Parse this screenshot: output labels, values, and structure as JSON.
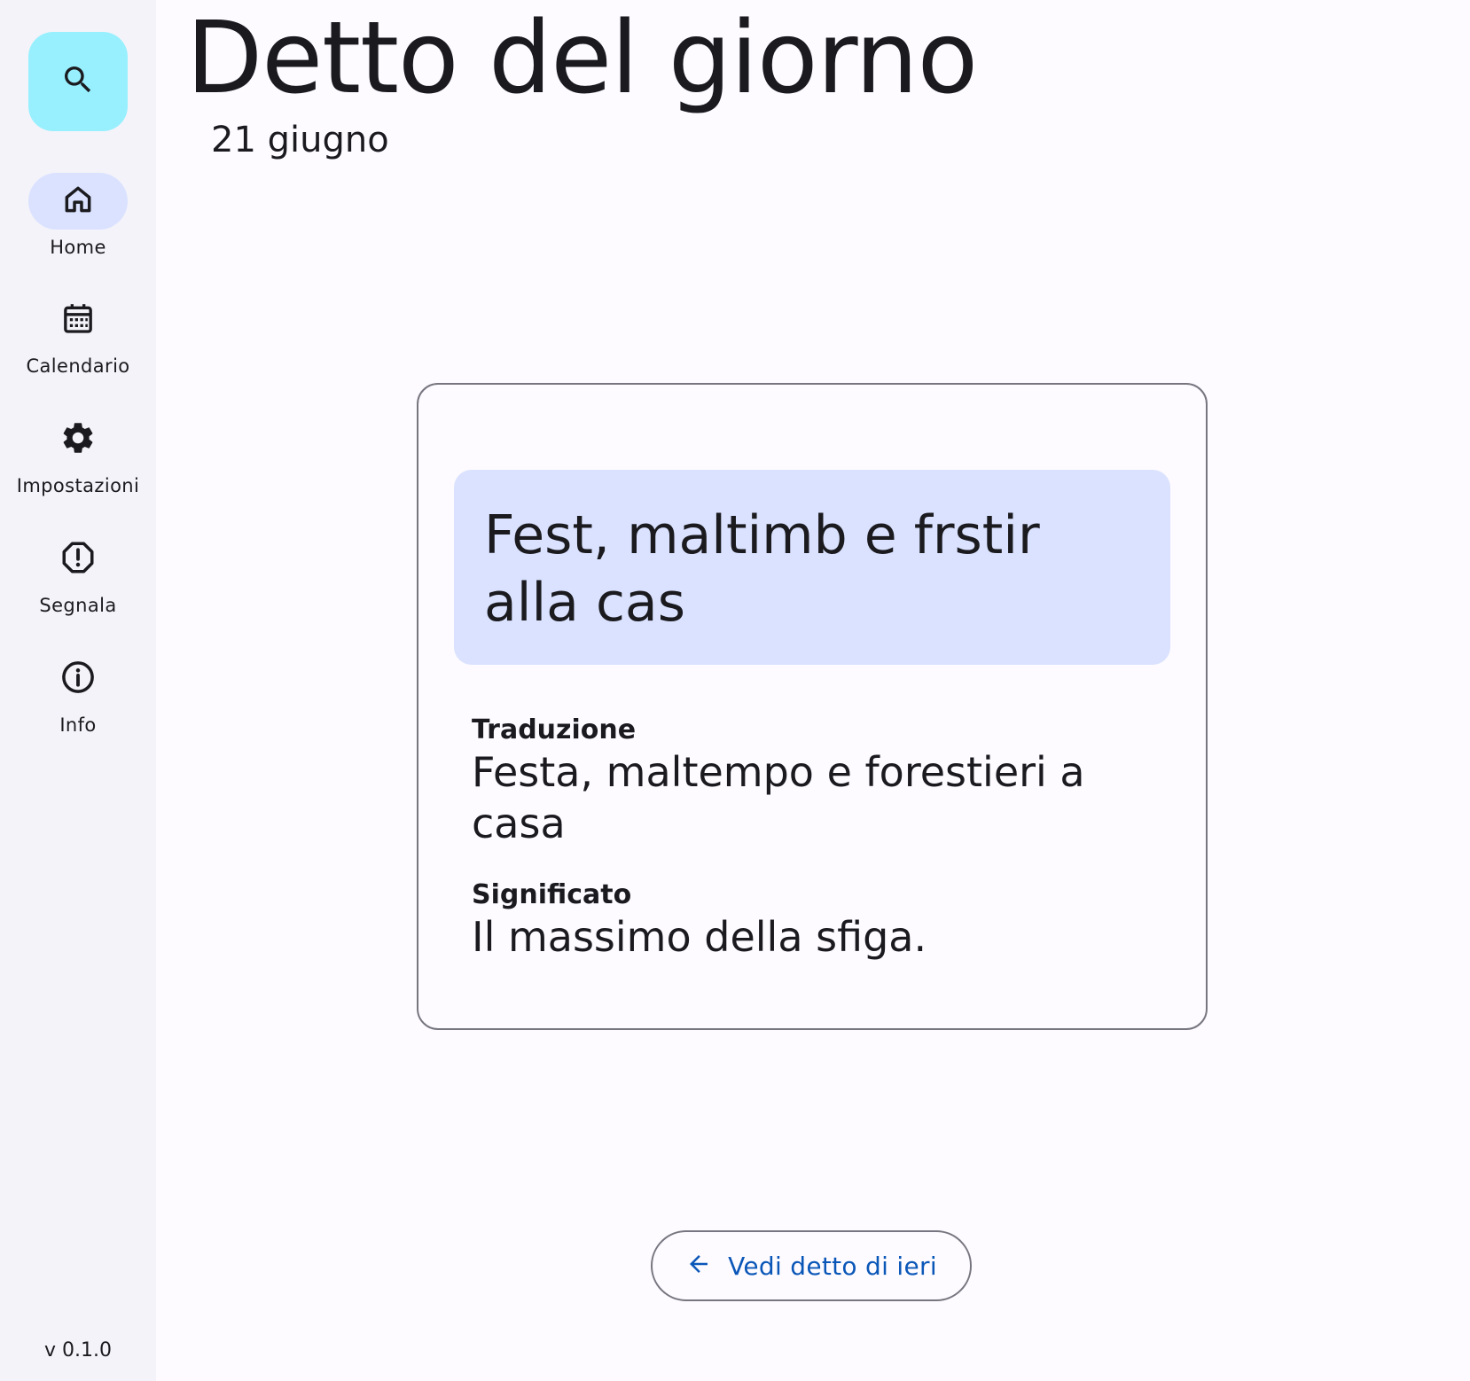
{
  "sidebar": {
    "search_icon": "search-icon",
    "items": [
      {
        "label": "Home",
        "icon": "home-icon",
        "active": true
      },
      {
        "label": "Calendario",
        "icon": "calendar-icon",
        "active": false
      },
      {
        "label": "Impostazioni",
        "icon": "gear-icon",
        "active": false
      },
      {
        "label": "Segnala",
        "icon": "report-icon",
        "active": false
      },
      {
        "label": "Info",
        "icon": "info-icon",
        "active": false
      }
    ],
    "version": "v 0.1.0"
  },
  "header": {
    "title": "Detto del giorno",
    "date": "21 giugno"
  },
  "card": {
    "saying": "Fest, maltimb e frstir alla cas",
    "translation_label": "Traduzione",
    "translation": "Festa, maltempo e forestieri a casa",
    "meaning_label": "Significato",
    "meaning": "Il massimo della sfiga."
  },
  "footer": {
    "prev_button_label": "Vedi detto di ieri"
  },
  "colors": {
    "fab": "#98f0ff",
    "active_indicator": "#dae2ff",
    "saying_box": "#dae2ff",
    "accent_text": "#0b57b8",
    "rail_bg": "#f4f3f9",
    "page_bg": "#fdfbff"
  }
}
